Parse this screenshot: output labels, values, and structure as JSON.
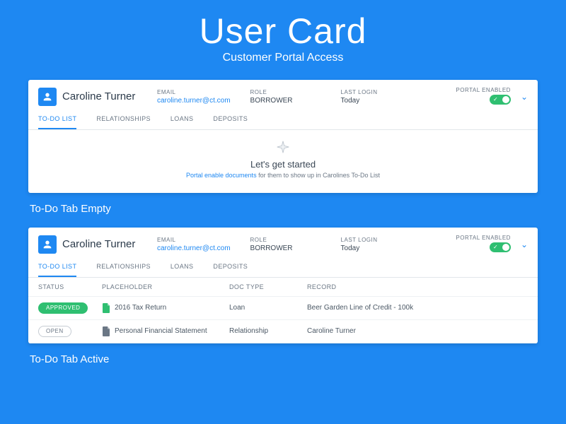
{
  "hero": {
    "title": "User Card",
    "subtitle": "Customer Portal Access"
  },
  "colors": {
    "brand": "#1e88f2",
    "success": "#2fbf71"
  },
  "user": {
    "name": "Caroline Turner",
    "email_label": "EMAIL",
    "email": "caroline.turner@ct.com",
    "role_label": "ROLE",
    "role": "BORROWER",
    "last_login_label": "LAST LOGIN",
    "last_login": "Today",
    "portal_label": "PORTAL ENABLED",
    "portal_enabled": true
  },
  "tabs": [
    {
      "label": "TO-DO LIST",
      "active": true
    },
    {
      "label": "RELATIONSHIPS",
      "active": false
    },
    {
      "label": "LOANS",
      "active": false
    },
    {
      "label": "DEPOSITS",
      "active": false
    }
  ],
  "empty_state": {
    "title": "Let's get started",
    "link_text": "Portal enable documents",
    "after_text": " for them to show up in Carolines To-Do List"
  },
  "section_labels": {
    "empty": "To-Do Tab Empty",
    "active": "To-Do Tab Active"
  },
  "table": {
    "columns": {
      "status": "STATUS",
      "placeholder": "PLACEHOLDER",
      "doctype": "DOC TYPE",
      "record": "RECORD"
    },
    "rows": [
      {
        "status": "APPROVED",
        "status_kind": "approved",
        "icon_color": "#2fbf71",
        "placeholder": "2016 Tax Return",
        "doctype": "Loan",
        "record": "Beer Garden Line of Credit - 100k"
      },
      {
        "status": "OPEN",
        "status_kind": "open",
        "icon_color": "#6b7785",
        "placeholder": "Personal Financial Statement",
        "doctype": "Relationship",
        "record": "Caroline Turner"
      }
    ]
  }
}
